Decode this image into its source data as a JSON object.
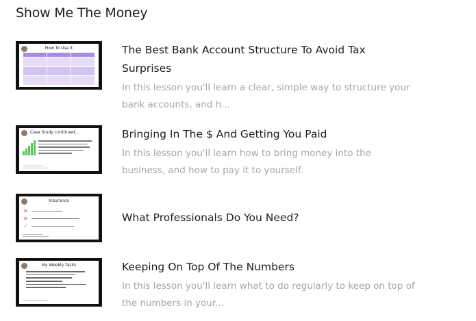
{
  "section": {
    "title": "Show Me The Money"
  },
  "lessons": [
    {
      "title": "The Best Bank Account Structure To Avoid Tax Surprises",
      "description": "In this lesson you'll learn a clear, simple way to structure your bank accounts, and h...",
      "thumb_title": "How To Use It"
    },
    {
      "title": "Bringing In The $ And Getting You Paid",
      "description": "In this lesson you'll learn how to bring money into the business, and how to pay it to yourself.",
      "thumb_title": "Case Study continued..."
    },
    {
      "title": "What Professionals Do You Need?",
      "description": "",
      "thumb_title": "Insurance"
    },
    {
      "title": "Keeping On Top Of The Numbers",
      "description": "In this lesson you'll learn what to do regularly to keep on top of the numbers in your...",
      "thumb_title": "My Weekly Tasks"
    }
  ],
  "colors": {
    "title": "#1d1d1d",
    "description": "#a6a6a6",
    "thumb_frame": "#111111",
    "grid_accent": "#a98be6"
  }
}
